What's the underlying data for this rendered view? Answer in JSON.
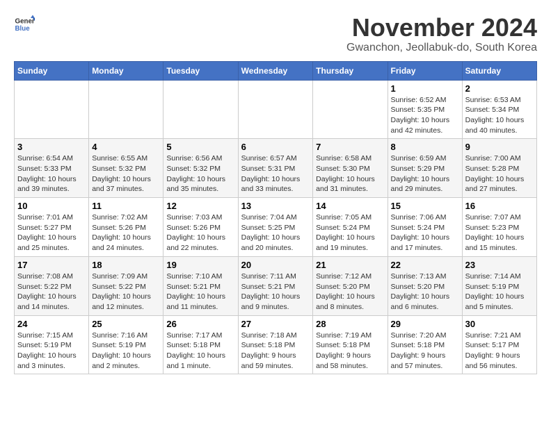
{
  "header": {
    "logo_line1": "General",
    "logo_line2": "Blue",
    "month": "November 2024",
    "location": "Gwanchon, Jeollabuk-do, South Korea"
  },
  "weekdays": [
    "Sunday",
    "Monday",
    "Tuesday",
    "Wednesday",
    "Thursday",
    "Friday",
    "Saturday"
  ],
  "weeks": [
    [
      {
        "day": "",
        "info": ""
      },
      {
        "day": "",
        "info": ""
      },
      {
        "day": "",
        "info": ""
      },
      {
        "day": "",
        "info": ""
      },
      {
        "day": "",
        "info": ""
      },
      {
        "day": "1",
        "info": "Sunrise: 6:52 AM\nSunset: 5:35 PM\nDaylight: 10 hours and 42 minutes."
      },
      {
        "day": "2",
        "info": "Sunrise: 6:53 AM\nSunset: 5:34 PM\nDaylight: 10 hours and 40 minutes."
      }
    ],
    [
      {
        "day": "3",
        "info": "Sunrise: 6:54 AM\nSunset: 5:33 PM\nDaylight: 10 hours and 39 minutes."
      },
      {
        "day": "4",
        "info": "Sunrise: 6:55 AM\nSunset: 5:32 PM\nDaylight: 10 hours and 37 minutes."
      },
      {
        "day": "5",
        "info": "Sunrise: 6:56 AM\nSunset: 5:32 PM\nDaylight: 10 hours and 35 minutes."
      },
      {
        "day": "6",
        "info": "Sunrise: 6:57 AM\nSunset: 5:31 PM\nDaylight: 10 hours and 33 minutes."
      },
      {
        "day": "7",
        "info": "Sunrise: 6:58 AM\nSunset: 5:30 PM\nDaylight: 10 hours and 31 minutes."
      },
      {
        "day": "8",
        "info": "Sunrise: 6:59 AM\nSunset: 5:29 PM\nDaylight: 10 hours and 29 minutes."
      },
      {
        "day": "9",
        "info": "Sunrise: 7:00 AM\nSunset: 5:28 PM\nDaylight: 10 hours and 27 minutes."
      }
    ],
    [
      {
        "day": "10",
        "info": "Sunrise: 7:01 AM\nSunset: 5:27 PM\nDaylight: 10 hours and 25 minutes."
      },
      {
        "day": "11",
        "info": "Sunrise: 7:02 AM\nSunset: 5:26 PM\nDaylight: 10 hours and 24 minutes."
      },
      {
        "day": "12",
        "info": "Sunrise: 7:03 AM\nSunset: 5:26 PM\nDaylight: 10 hours and 22 minutes."
      },
      {
        "day": "13",
        "info": "Sunrise: 7:04 AM\nSunset: 5:25 PM\nDaylight: 10 hours and 20 minutes."
      },
      {
        "day": "14",
        "info": "Sunrise: 7:05 AM\nSunset: 5:24 PM\nDaylight: 10 hours and 19 minutes."
      },
      {
        "day": "15",
        "info": "Sunrise: 7:06 AM\nSunset: 5:24 PM\nDaylight: 10 hours and 17 minutes."
      },
      {
        "day": "16",
        "info": "Sunrise: 7:07 AM\nSunset: 5:23 PM\nDaylight: 10 hours and 15 minutes."
      }
    ],
    [
      {
        "day": "17",
        "info": "Sunrise: 7:08 AM\nSunset: 5:22 PM\nDaylight: 10 hours and 14 minutes."
      },
      {
        "day": "18",
        "info": "Sunrise: 7:09 AM\nSunset: 5:22 PM\nDaylight: 10 hours and 12 minutes."
      },
      {
        "day": "19",
        "info": "Sunrise: 7:10 AM\nSunset: 5:21 PM\nDaylight: 10 hours and 11 minutes."
      },
      {
        "day": "20",
        "info": "Sunrise: 7:11 AM\nSunset: 5:21 PM\nDaylight: 10 hours and 9 minutes."
      },
      {
        "day": "21",
        "info": "Sunrise: 7:12 AM\nSunset: 5:20 PM\nDaylight: 10 hours and 8 minutes."
      },
      {
        "day": "22",
        "info": "Sunrise: 7:13 AM\nSunset: 5:20 PM\nDaylight: 10 hours and 6 minutes."
      },
      {
        "day": "23",
        "info": "Sunrise: 7:14 AM\nSunset: 5:19 PM\nDaylight: 10 hours and 5 minutes."
      }
    ],
    [
      {
        "day": "24",
        "info": "Sunrise: 7:15 AM\nSunset: 5:19 PM\nDaylight: 10 hours and 3 minutes."
      },
      {
        "day": "25",
        "info": "Sunrise: 7:16 AM\nSunset: 5:19 PM\nDaylight: 10 hours and 2 minutes."
      },
      {
        "day": "26",
        "info": "Sunrise: 7:17 AM\nSunset: 5:18 PM\nDaylight: 10 hours and 1 minute."
      },
      {
        "day": "27",
        "info": "Sunrise: 7:18 AM\nSunset: 5:18 PM\nDaylight: 9 hours and 59 minutes."
      },
      {
        "day": "28",
        "info": "Sunrise: 7:19 AM\nSunset: 5:18 PM\nDaylight: 9 hours and 58 minutes."
      },
      {
        "day": "29",
        "info": "Sunrise: 7:20 AM\nSunset: 5:18 PM\nDaylight: 9 hours and 57 minutes."
      },
      {
        "day": "30",
        "info": "Sunrise: 7:21 AM\nSunset: 5:17 PM\nDaylight: 9 hours and 56 minutes."
      }
    ]
  ]
}
